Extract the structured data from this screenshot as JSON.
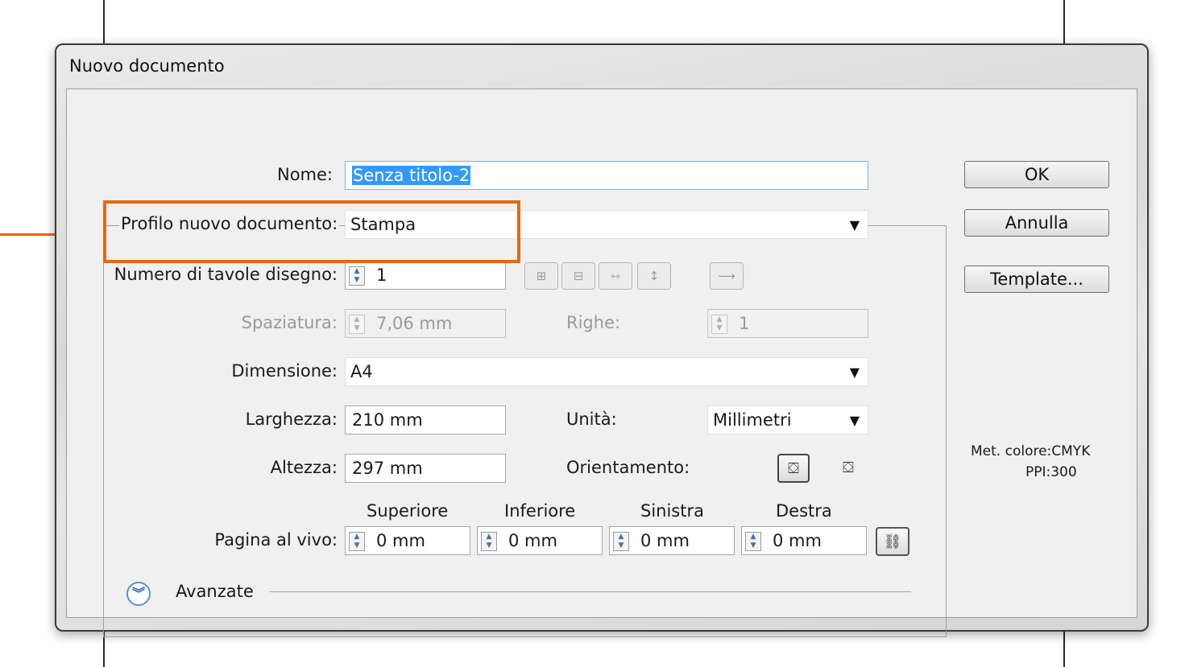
{
  "dialog": {
    "title": "Nuovo documento",
    "name_label": "Nome:",
    "name_value": "Senza titolo-2",
    "profile_label": "Profilo nuovo documento:",
    "profile_value": "Stampa",
    "artboards_label": "Numero di tavole disegno:",
    "artboards_value": "1",
    "spacing_label": "Spaziatura:",
    "spacing_value": "7,06 mm",
    "rows_label": "Righe:",
    "rows_value": "1",
    "size_label": "Dimensione:",
    "size_value": "A4",
    "width_label": "Larghezza:",
    "width_value": "210 mm",
    "units_label": "Unità:",
    "units_value": "Millimetri",
    "height_label": "Altezza:",
    "height_value": "297 mm",
    "orientation_label": "Orientamento:",
    "bleed_label": "Pagina al vivo:",
    "bleed_headers": [
      "Superiore",
      "Inferiore",
      "Sinistra",
      "Destra"
    ],
    "bleed_values": [
      "0 mm",
      "0 mm",
      "0 mm",
      "0 mm"
    ],
    "advanced_label": "Avanzate",
    "buttons": {
      "ok": "OK",
      "cancel": "Annulla",
      "template": "Template..."
    },
    "info": {
      "color_mode": "Met. colore:CMYK",
      "ppi": "PPI:300"
    }
  },
  "icons": {
    "grid_by_row": "grid-by-row-icon",
    "grid_by_column": "grid-by-column-icon",
    "arrange_by_row": "arrange-by-row-icon",
    "arrange_by_column": "arrange-by-column-icon",
    "layout_direction": "arrow-right-icon",
    "portrait": "portrait-orientation-icon",
    "landscape": "landscape-orientation-icon",
    "link": "chain-link-icon",
    "expand": "chevron-down-icon"
  },
  "colors": {
    "highlight": "#e06a14",
    "selection": "#3399ff"
  }
}
